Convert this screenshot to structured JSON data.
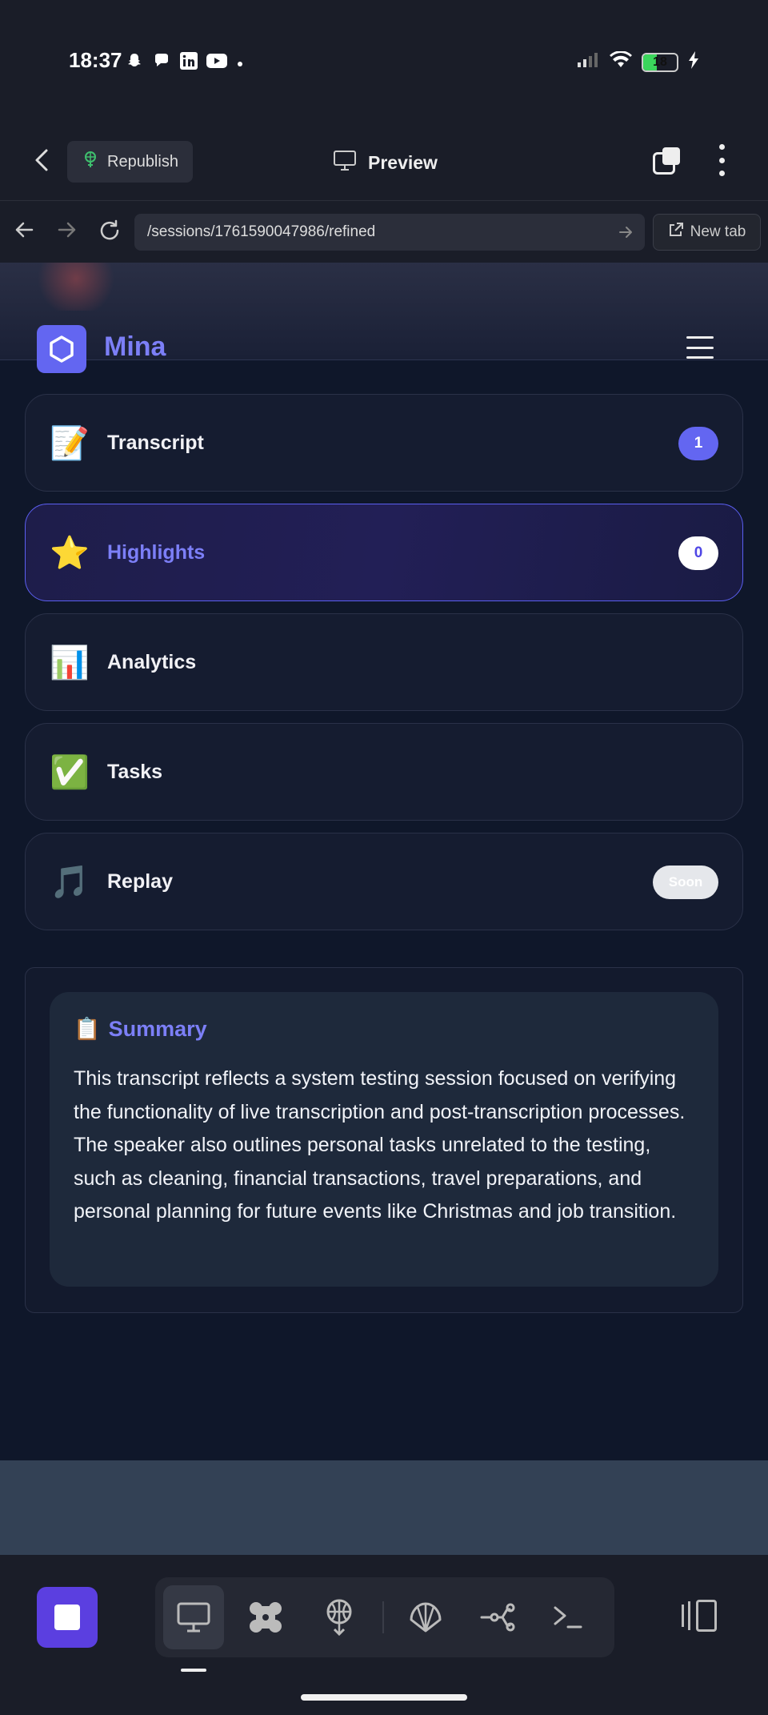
{
  "status_bar": {
    "time": "18:37",
    "battery": "18"
  },
  "app_bar": {
    "republish_label": "Republish",
    "preview_label": "Preview"
  },
  "url_bar": {
    "url": "/sessions/1761590047986/refined",
    "new_tab_label": "New tab"
  },
  "site": {
    "brand": "Mina"
  },
  "nav_items": [
    {
      "emoji": "📝",
      "label": "Transcript",
      "badge": "1"
    },
    {
      "emoji": "⭐",
      "label": "Highlights",
      "badge": "0"
    },
    {
      "emoji": "📊",
      "label": "Analytics"
    },
    {
      "emoji": "✅",
      "label": "Tasks"
    },
    {
      "emoji": "🎵",
      "label": "Replay",
      "badge": "Soon"
    }
  ],
  "summary": {
    "icon": "📋",
    "title": "Summary",
    "text": "This transcript reflects a system testing session focused on verifying the functionality of live transcription and post-transcription processes. The speaker also outlines personal tasks unrelated to the testing, such as cleaning, financial transactions, travel preparations, and personal planning for future events like Christmas and job transition."
  },
  "colors": {
    "accent": "#6366f1",
    "accent_text": "#7c7ff7",
    "page_bg": "#0f172a",
    "card_bg": "#151c30"
  }
}
